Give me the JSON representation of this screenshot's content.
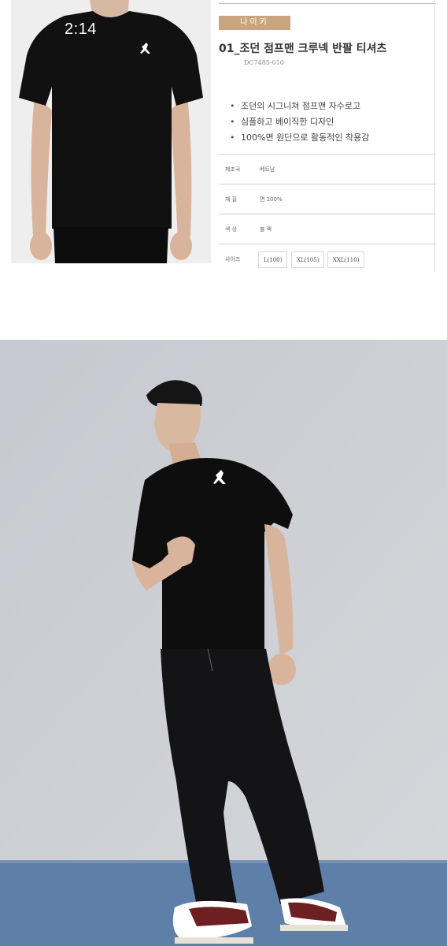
{
  "status_bar": {
    "time": "2:14"
  },
  "product": {
    "brand": "나이키",
    "title": "01_조던 점프맨 크루넥 반팔 티셔츠",
    "code": "DC7485-010",
    "features": [
      "조던의 시그니쳐 점프맨 자수로고",
      "심플하고 베이직한 디자인",
      "100%면 원단으로 활동적인 착용감"
    ],
    "specs": [
      {
        "label": "제조국",
        "value": "베트남"
      },
      {
        "label": "재 질",
        "value": "면 100%"
      },
      {
        "label": "색 상",
        "value": "블 랙"
      }
    ],
    "size_label": "사이즈",
    "sizes": [
      "L(100)",
      "XL(105)",
      "XXL(110)"
    ]
  },
  "images": {
    "top": {
      "icon": "tshirt-model-photo",
      "colors": {
        "shirt": "#111111",
        "background": "#eeeeee"
      }
    },
    "bottom": {
      "icon": "full-body-model-photo",
      "colors": {
        "wall": "#c9ccd1",
        "floor": "#5e7fa8",
        "sneaker_red": "#6e1f22"
      }
    }
  }
}
